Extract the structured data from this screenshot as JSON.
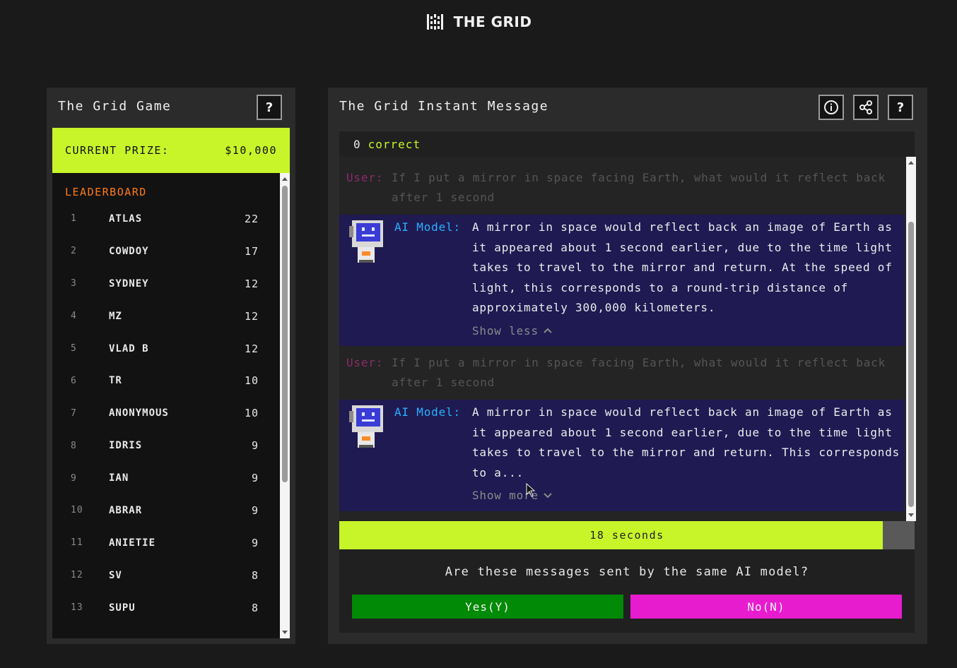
{
  "header": {
    "title": "THE GRID",
    "logo_icon": "grid-logo-icon"
  },
  "game_panel": {
    "title": "The Grid Game",
    "help_label": "?",
    "prize": {
      "label": "CURRENT PRIZE:",
      "value": "$10,000"
    },
    "leaderboard": {
      "title": "LEADERBOARD",
      "rows": [
        {
          "rank": "1",
          "name": "ATLAS",
          "score": "22"
        },
        {
          "rank": "2",
          "name": "COWDOY",
          "score": "17"
        },
        {
          "rank": "3",
          "name": "SYDNEY",
          "score": "12"
        },
        {
          "rank": "4",
          "name": "MZ",
          "score": "12"
        },
        {
          "rank": "5",
          "name": "VLAD B",
          "score": "12"
        },
        {
          "rank": "6",
          "name": "TR",
          "score": "10"
        },
        {
          "rank": "7",
          "name": "ANONYMOUS",
          "score": "10"
        },
        {
          "rank": "8",
          "name": "IDRIS",
          "score": "9"
        },
        {
          "rank": "9",
          "name": "IAN",
          "score": "9"
        },
        {
          "rank": "10",
          "name": "ABRAR",
          "score": "9"
        },
        {
          "rank": "11",
          "name": "ANIETIE",
          "score": "9"
        },
        {
          "rank": "12",
          "name": "SV",
          "score": "8"
        },
        {
          "rank": "13",
          "name": "SUPU",
          "score": "8"
        }
      ]
    }
  },
  "message_panel": {
    "title": "The Grid Instant Message",
    "info_label": "i",
    "help_label": "?",
    "score": {
      "count": "0",
      "label": "correct"
    },
    "messages": [
      {
        "role": "User:",
        "text": "If I put a mirror in space facing Earth, what would it reflect back after 1 second"
      },
      {
        "role": "AI Model:",
        "text": "A mirror in space would reflect back an image of Earth as it appeared about 1 second earlier, due to the time light takes to travel to the mirror and return. At the speed of light, this corresponds to a round-trip distance of approximately 300,000 kilometers.",
        "toggle": "Show less"
      },
      {
        "role": "User:",
        "text": "If I put a mirror in space facing Earth, what would it reflect back after 1 second"
      },
      {
        "role": "AI Model:",
        "text": "A mirror in space would reflect back an image of Earth as it appeared about 1 second earlier, due to the time light takes to travel to the mirror and return. This corresponds to a...",
        "toggle": "Show more"
      }
    ],
    "timer": {
      "text": "18 seconds",
      "remaining_fraction": 0.945
    },
    "question": "Are these messages sent by the same AI model?",
    "yes_label": "Yes(Y)",
    "no_label": "No(N)"
  },
  "colors": {
    "accent": "#c7f52a",
    "yes": "#008a05",
    "no": "#e81ccf",
    "ai_bg": "#1f1a52",
    "leaderboard_title": "#ff7a1a"
  }
}
